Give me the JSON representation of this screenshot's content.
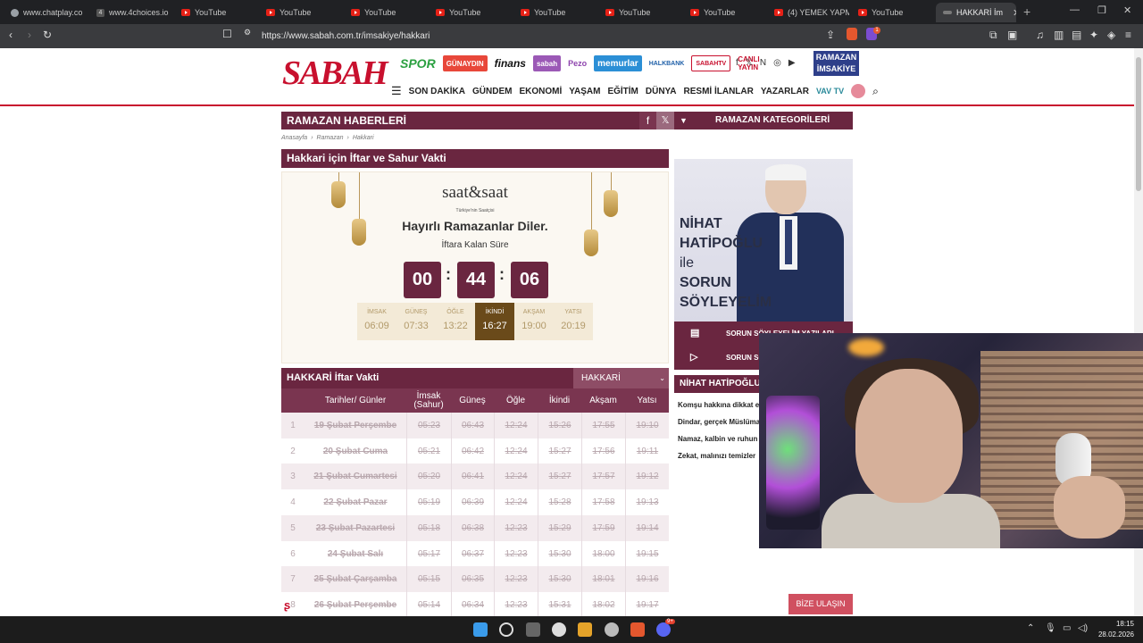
{
  "browser": {
    "tabs": [
      {
        "label": "www.chatplay.co",
        "icon": "globe-icon"
      },
      {
        "label": "www.4choices.io",
        "icon": "num-icon",
        "badge": "4"
      },
      {
        "label": "YouTube",
        "icon": "youtube-icon"
      },
      {
        "label": "YouTube",
        "icon": "youtube-icon"
      },
      {
        "label": "YouTube",
        "icon": "youtube-icon"
      },
      {
        "label": "YouTube",
        "icon": "youtube-icon"
      },
      {
        "label": "YouTube",
        "icon": "youtube-icon"
      },
      {
        "label": "YouTube",
        "icon": "youtube-icon"
      },
      {
        "label": "YouTube",
        "icon": "youtube-icon"
      },
      {
        "label": "(4) YEMEK YAPM",
        "icon": "youtube-icon"
      },
      {
        "label": "YouTube",
        "icon": "youtube-icon"
      },
      {
        "label": "HAKKARİ İm",
        "icon": "sabah-icon",
        "active": true
      }
    ],
    "url": "https://www.sabah.com.tr/imsakiye/hakkari",
    "notification_count": "1"
  },
  "site": {
    "logo": "SABAH",
    "partners": [
      "SPOR",
      "GÜNAYDIN",
      "finans",
      "sabah",
      "Pezo",
      "memurlar",
      "HALKBANK",
      "SABAHTV",
      "CANLI YAYIN"
    ],
    "ramazan_button": "RAMAZAN İMSAKİYE",
    "nav": [
      "SON DAKİKA",
      "GÜNDEM",
      "EKONOMİ",
      "YAŞAM",
      "EĞİTİM",
      "DÜNYA",
      "RESMİ İLANLAR",
      "YAZARLAR"
    ],
    "vavtv": "VAV TV"
  },
  "page": {
    "section_title": "RAMAZAN HABERLERİ",
    "category_button": "RAMAZAN KATEGORİLERİ",
    "breadcrumb": [
      "Anasayfa",
      "Ramazan",
      "Hakkari"
    ],
    "main_title": "Hakkari için İftar ve Sahur Vakti"
  },
  "countdown": {
    "brand": "saat&saat",
    "brand_sub": "Türkiye'nin Saatçisi",
    "greeting": "Hayırlı Ramazanlar Diler.",
    "remaining_label": "İftara Kalan Süre",
    "hours": "00",
    "minutes": "44",
    "seconds": "06",
    "prayers": [
      {
        "name": "İMSAK",
        "time": "06:09"
      },
      {
        "name": "GÜNEŞ",
        "time": "07:33"
      },
      {
        "name": "ÖĞLE",
        "time": "13:22"
      },
      {
        "name": "İKİNDİ",
        "time": "16:27"
      },
      {
        "name": "AKŞAM",
        "time": "19:00"
      },
      {
        "name": "YATSI",
        "time": "20:19"
      }
    ]
  },
  "timetable": {
    "title": "HAKKARİ İftar Vakti",
    "city_select": "HAKKARİ",
    "headers": [
      "Tarihler/ Günler",
      "İmsak (Sahur)",
      "Güneş",
      "Öğle",
      "İkindi",
      "Akşam",
      "Yatsı"
    ],
    "rows": [
      {
        "n": "1",
        "date": "19 Şubat Perşembe",
        "imsak": "05:23",
        "gunes": "06:43",
        "ogle": "12:24",
        "ikindi": "15:26",
        "aksam": "17:55",
        "yatsi": "19:10"
      },
      {
        "n": "2",
        "date": "20 Şubat Cuma",
        "imsak": "05:21",
        "gunes": "06:42",
        "ogle": "12:24",
        "ikindi": "15:27",
        "aksam": "17:56",
        "yatsi": "19:11"
      },
      {
        "n": "3",
        "date": "21 Şubat Cumartesi",
        "imsak": "05:20",
        "gunes": "06:41",
        "ogle": "12:24",
        "ikindi": "15:27",
        "aksam": "17:57",
        "yatsi": "19:12"
      },
      {
        "n": "4",
        "date": "22 Şubat Pazar",
        "imsak": "05:19",
        "gunes": "06:39",
        "ogle": "12:24",
        "ikindi": "15:28",
        "aksam": "17:58",
        "yatsi": "19:13"
      },
      {
        "n": "5",
        "date": "23 Şubat Pazartesi",
        "imsak": "05:18",
        "gunes": "06:38",
        "ogle": "12:23",
        "ikindi": "15:29",
        "aksam": "17:59",
        "yatsi": "19:14"
      },
      {
        "n": "6",
        "date": "24 Şubat Salı",
        "imsak": "05:17",
        "gunes": "06:37",
        "ogle": "12:23",
        "ikindi": "15:30",
        "aksam": "18:00",
        "yatsi": "19:15"
      },
      {
        "n": "7",
        "date": "25 Şubat Çarşamba",
        "imsak": "05:15",
        "gunes": "06:35",
        "ogle": "12:23",
        "ikindi": "15:30",
        "aksam": "18:01",
        "yatsi": "19:16"
      },
      {
        "n": "8",
        "date": "26 Şubat Perşembe",
        "imsak": "05:14",
        "gunes": "06:34",
        "ogle": "12:23",
        "ikindi": "15:31",
        "aksam": "18:02",
        "yatsi": "19:17"
      }
    ]
  },
  "sidebar": {
    "promo_lines": [
      "NİHAT",
      "HATİPOĞLU",
      "ile",
      "SORUN",
      "SÖYLEYELİM"
    ],
    "links": [
      "SORUN SÖYLEYELİM YAZILARI",
      "SORUN SÖ"
    ],
    "section_head": "NİHAT HATİPOĞLU",
    "items": [
      "Komşu hakkına dikkat edi",
      "Dindar, gerçek Müslüman",
      "Namaz, kalbin ve ruhun g",
      "Zekat, malınızı temizler"
    ]
  },
  "contact_button": "BİZE ULAŞIN",
  "taskbar": {
    "time": "18:15",
    "date": "28.02.2026",
    "discord_badge": "9+"
  }
}
